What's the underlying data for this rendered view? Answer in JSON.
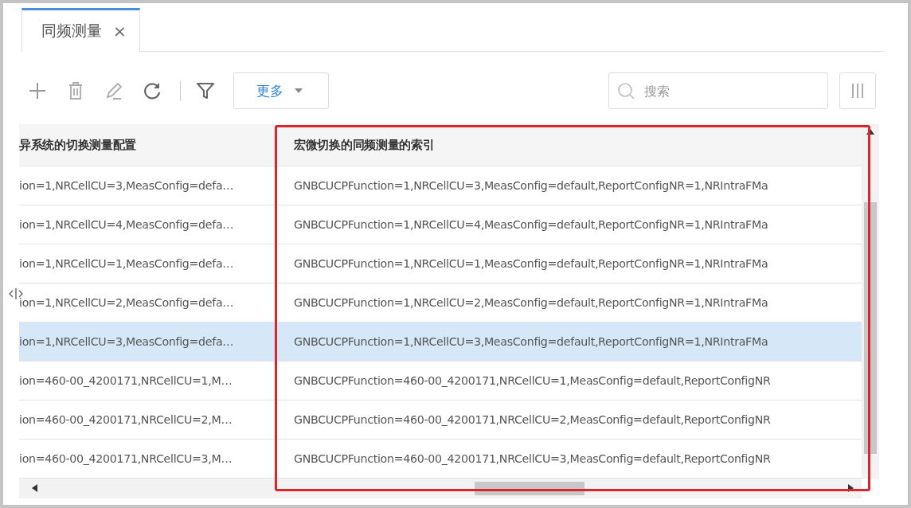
{
  "tabs": [
    {
      "label": "同频测量",
      "close": "×",
      "selected": true
    }
  ],
  "toolbar": {
    "more_button": "更多",
    "search": {
      "placeholder": "搜索"
    }
  },
  "table": {
    "columns": [
      "异系统的切换测量配置",
      "宏微切换的同频测量的索引"
    ],
    "rows": [
      {
        "cells": [
          "ion=1,NRCellCU=3,MeasConfig=defa…",
          "GNBCUCPFunction=1,NRCellCU=3,MeasConfig=default,ReportConfigNR=1,NRIntraFMa"
        ],
        "selected": false
      },
      {
        "cells": [
          "ion=1,NRCellCU=4,MeasConfig=defa…",
          "GNBCUCPFunction=1,NRCellCU=4,MeasConfig=default,ReportConfigNR=1,NRIntraFMa"
        ],
        "selected": false
      },
      {
        "cells": [
          "ion=1,NRCellCU=1,MeasConfig=defa…",
          "GNBCUCPFunction=1,NRCellCU=1,MeasConfig=default,ReportConfigNR=1,NRIntraFMa"
        ],
        "selected": false
      },
      {
        "cells": [
          "ion=1,NRCellCU=2,MeasConfig=defa…",
          "GNBCUCPFunction=1,NRCellCU=2,MeasConfig=default,ReportConfigNR=1,NRIntraFMa"
        ],
        "selected": false
      },
      {
        "cells": [
          "ion=1,NRCellCU=3,MeasConfig=defa…",
          "GNBCUCPFunction=1,NRCellCU=3,MeasConfig=default,ReportConfigNR=1,NRIntraFMa"
        ],
        "selected": true
      },
      {
        "cells": [
          "ion=460-00_4200171,NRCellCU=1,M…",
          "GNBCUCPFunction=460-00_4200171,NRCellCU=1,MeasConfig=default,ReportConfigNR"
        ],
        "selected": false
      },
      {
        "cells": [
          "ion=460-00_4200171,NRCellCU=2,M…",
          "GNBCUCPFunction=460-00_4200171,NRCellCU=2,MeasConfig=default,ReportConfigNR"
        ],
        "selected": false
      },
      {
        "cells": [
          "ion=460-00_4200171,NRCellCU=3,M…",
          "GNBCUCPFunction=460-00_4200171,NRCellCU=3,MeasConfig=default,ReportConfigNR"
        ],
        "selected": false
      }
    ]
  }
}
